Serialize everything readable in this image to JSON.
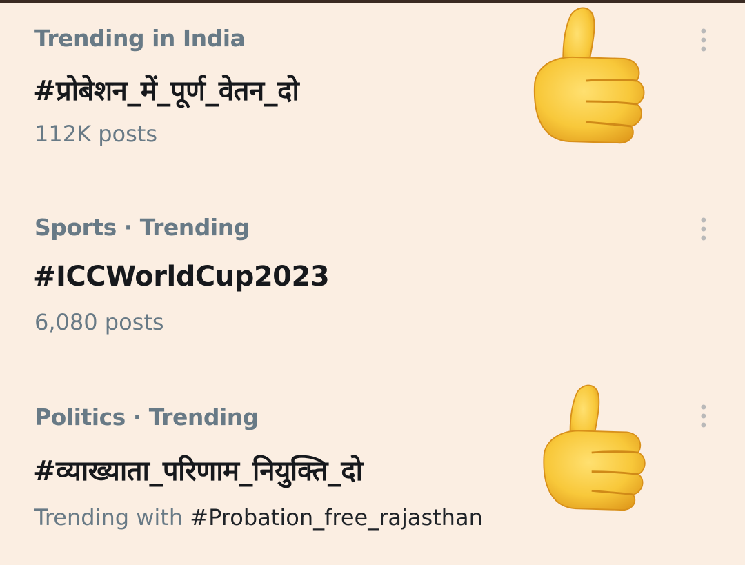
{
  "trends": [
    {
      "context": "Trending in India",
      "title": "#प्रोबेशन_में_पूर्ण_वेतन_दो",
      "meta": "112K posts"
    },
    {
      "context": "Sports · Trending",
      "title": "#ICCWorldCup2023",
      "meta": "6,080 posts"
    },
    {
      "context": "Politics · Trending",
      "title": "#व्याख्याता_परिणाम_नियुक्ति_दो",
      "meta_prefix": "Trending with ",
      "meta_hashtag": "#Probation_free_rajasthan"
    }
  ],
  "icons": {
    "more": "more-vertical-icon",
    "thumb": "thumbs-up-emoji"
  },
  "colors": {
    "background": "#fbeee2",
    "secondary_text": "#687a86",
    "primary_text": "#16181c",
    "thumb_fill": "#f8c83a"
  }
}
